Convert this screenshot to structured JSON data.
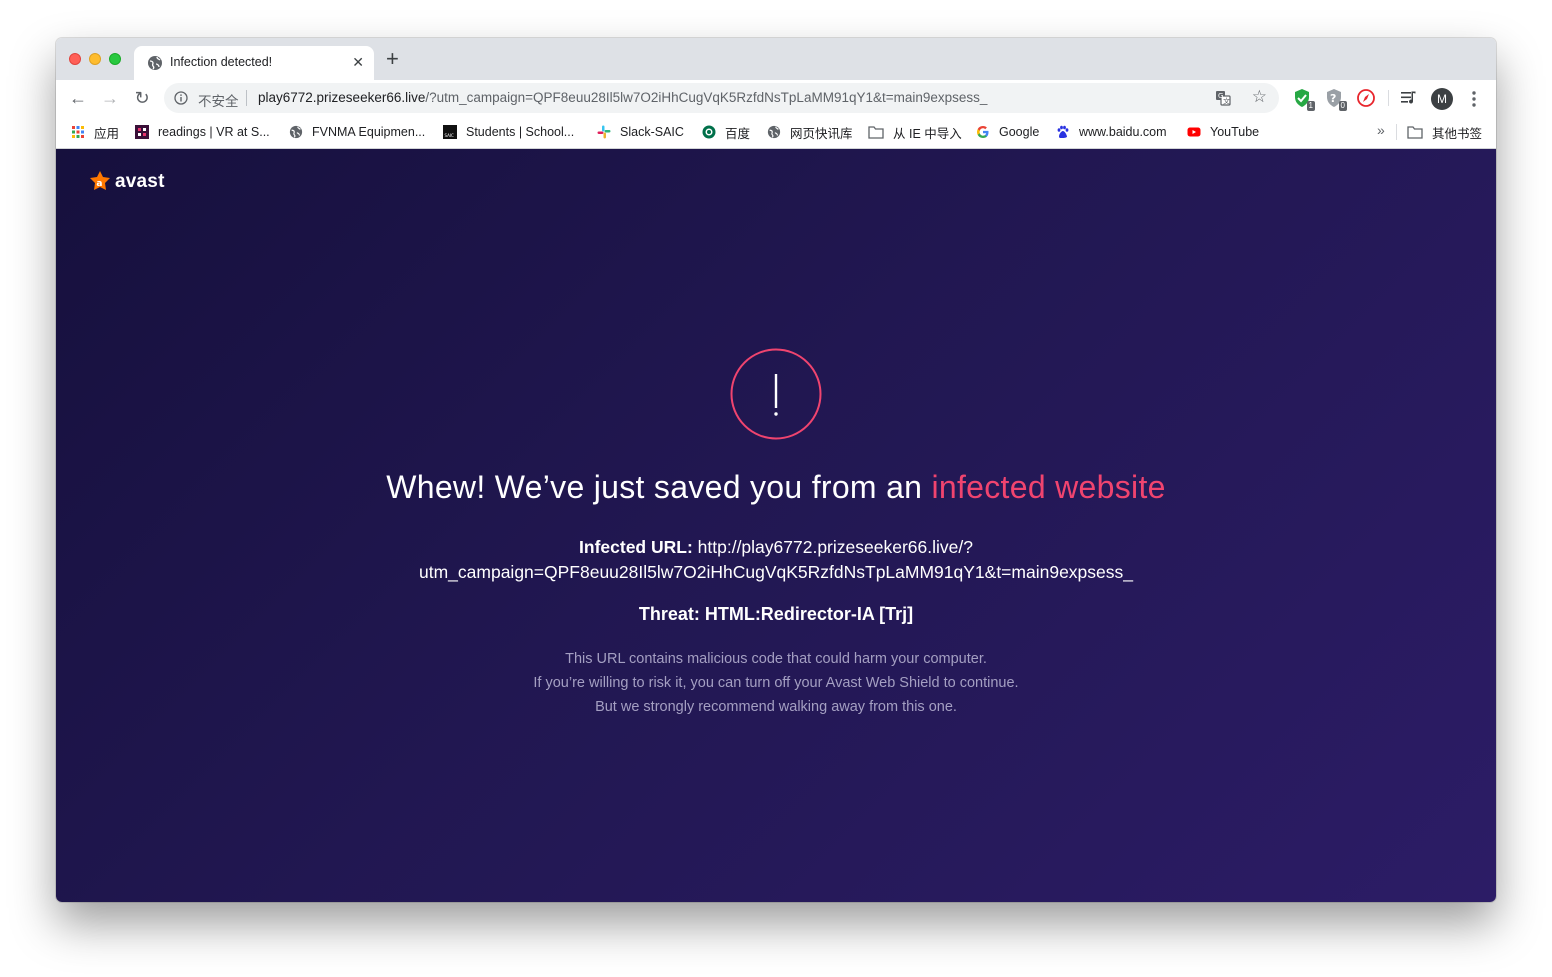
{
  "browser": {
    "tab": {
      "title": "Infection detected!",
      "close_glyph": "✕"
    },
    "new_tab_glyph": "+",
    "nav": {
      "back": "←",
      "forward": "→",
      "reload": "↻"
    },
    "omnibox": {
      "security_label": "不安全",
      "url_host": "play6772.prizeseeker66.live",
      "url_rest": "/?utm_campaign=QPF8euu28Il5lw7O2iHhCugVqK5RzfdNsTpLaMM91qY1&t=main9expsess_"
    },
    "extensions": [
      {
        "icon": "shield-check-icon",
        "badge": "1"
      },
      {
        "icon": "question-shield-icon",
        "badge": "0"
      },
      {
        "icon": "compass-icon",
        "badge": ""
      }
    ],
    "profile_initial": "M",
    "bookmarks": [
      {
        "label": "应用",
        "icon": "apps-grid-icon"
      },
      {
        "label": "readings | VR at S...",
        "icon": "readings-favicon"
      },
      {
        "label": "FVNMA Equipmen...",
        "icon": "globe-icon"
      },
      {
        "label": "Students | School...",
        "icon": "saic-favicon"
      },
      {
        "label": "Slack-SAIC",
        "icon": "slack-icon"
      },
      {
        "label": "百度",
        "icon": "starbucks-icon"
      },
      {
        "label": "网页快讯库",
        "icon": "globe-icon"
      },
      {
        "label": "从 IE 中导入",
        "icon": "folder-icon"
      },
      {
        "label": "Google",
        "icon": "google-icon"
      },
      {
        "label": "www.baidu.com",
        "icon": "baidu-icon"
      },
      {
        "label": "YouTube",
        "icon": "youtube-icon"
      }
    ],
    "bookmarks_overflow": "»",
    "other_bookmarks": "其他书签"
  },
  "page": {
    "brand": "avast",
    "headline_main": "Whew! We’ve just saved you from an ",
    "headline_highlight": "infected website",
    "infected_label": "Infected URL:",
    "infected_url_line1": "http://play6772.prizeseeker66.live/?",
    "infected_url_line2": "utm_campaign=QPF8euu28Il5lw7O2iHhCugVqK5RzfdNsTpLaMM91qY1&t=main9expsess_",
    "threat": "Threat: HTML:Redirector-IA [Trj]",
    "description": [
      "This URL contains malicious code that could harm your computer.",
      "If you’re willing to risk it, you can turn off your Avast Web Shield to continue.",
      "But we strongly recommend walking away from this one."
    ],
    "colors": {
      "accent": "#f0446f",
      "brand_orange": "#ff7800",
      "background": "#211751"
    }
  }
}
